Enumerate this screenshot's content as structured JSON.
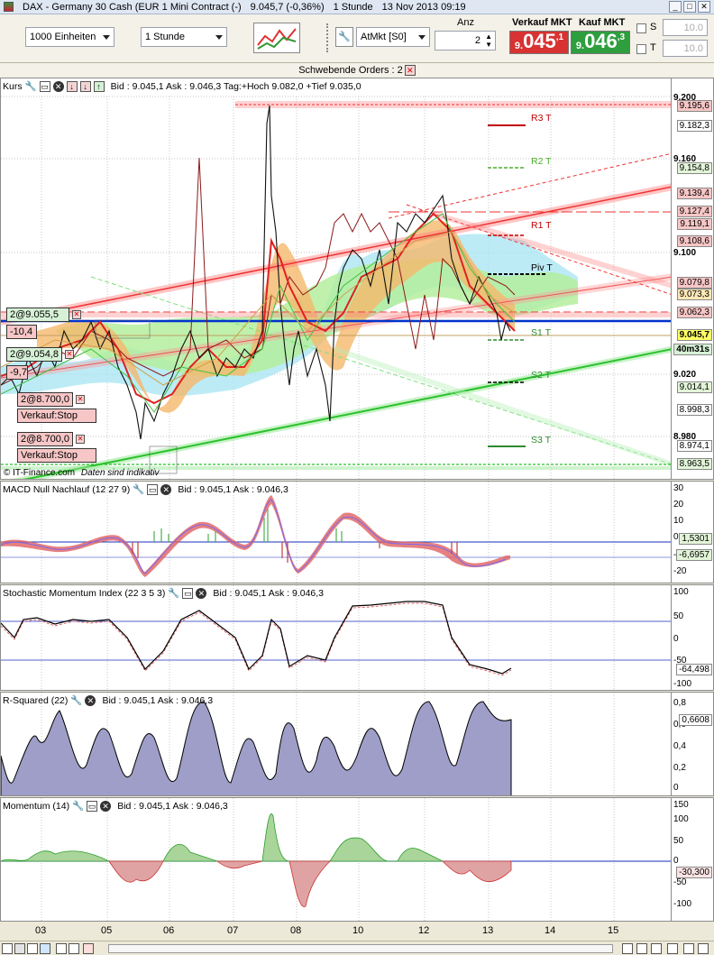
{
  "window": {
    "title": "DAX - Germany 30 Cash (EUR 1 Mini Contract (-)",
    "last": "9.045,7 (-0,36%)",
    "interval": "1 Stunde",
    "datetime": "13 Nov 2013 09:19",
    "controls": [
      "_",
      "□",
      "✕"
    ]
  },
  "toolbar": {
    "units": "1000 Einheiten",
    "timeframe": "1 Stunde",
    "order_type": "AtMkt [S0]",
    "qty_label": "Anz",
    "qty": "2",
    "sell_label": "Verkauf MKT",
    "sell_small": "9.",
    "sell_big": "045",
    "sell_sup": ",1",
    "buy_label": "Kauf MKT",
    "buy_small": "9.",
    "buy_big": "046",
    "buy_sup": ",3",
    "s_label": "S",
    "t_label": "T",
    "s_value": "10.0",
    "t_value": "10.0",
    "sell_color": "#d83232",
    "buy_color": "#2e9e3e"
  },
  "pending": {
    "label": "Schwebende Orders : 2"
  },
  "main": {
    "title": "Kurs",
    "info": "Bid : 9.045,1 Ask : 9.046,3 Tag:+Hoch 9.082,0 +Tief 9.035,0",
    "footer_left": "© IT-Finance.com",
    "footer_right": "Daten sind indikativ",
    "ticks": [
      "9.200",
      "9.160",
      "9.100",
      "9.020",
      "8.980"
    ],
    "price_labels": [
      {
        "v": "9.195,6",
        "c": "#f7c6c6"
      },
      {
        "v": "9.182,3",
        "c": "#fff"
      },
      {
        "v": "9.154,8",
        "c": "#e3f5d9"
      },
      {
        "v": "9.139,4",
        "c": "#f7c6c6"
      },
      {
        "v": "9.127,4",
        "c": "#f7c6c6"
      },
      {
        "v": "9.119,1",
        "c": "#f7c6c6"
      },
      {
        "v": "9.108,6",
        "c": "#f7c6c6"
      },
      {
        "v": "9.079,8",
        "c": "#f7c6c6"
      },
      {
        "v": "9.073,3",
        "c": "#fde8b7"
      },
      {
        "v": "9.062,3",
        "c": "#f7c6c6"
      },
      {
        "v": "9.045,7",
        "c": "#ffff66"
      },
      {
        "v": "40m31s",
        "c": "#d7f1d7"
      },
      {
        "v": "9.014,1",
        "c": "#e3f5d9"
      },
      {
        "v": "8.998,3",
        "c": "#fff"
      },
      {
        "v": "8.974,1",
        "c": "#fff"
      },
      {
        "v": "8.963,5",
        "c": "#e3f5d9"
      }
    ],
    "pivots": [
      {
        "l": "R3 T",
        "c": "#c00000"
      },
      {
        "l": "R2 T",
        "c": "#4caf2a"
      },
      {
        "l": "R1 T",
        "c": "#c00000"
      },
      {
        "l": "Piv T",
        "c": "#000"
      },
      {
        "l": "S1 T",
        "c": "#2e8b2e"
      },
      {
        "l": "S2 T",
        "c": "#2e8b2e"
      },
      {
        "l": "S3 T",
        "c": "#2e8b2e"
      }
    ],
    "orders": [
      {
        "t": "2@9.055,5",
        "c": "#d7f1d7"
      },
      {
        "t": "-10,4",
        "c": "#f7c6c6"
      },
      {
        "t": "2@9.054,8",
        "c": "#d7f1d7"
      },
      {
        "t": "-9,7",
        "c": "#f7c6c6"
      },
      {
        "t": "2@8.700,0",
        "c": "#f7c6c6"
      },
      {
        "t": "Verkauf:Stop",
        "c": "#f7c6c6"
      },
      {
        "t": "2@8.700,0",
        "c": "#f7c6c6"
      },
      {
        "t": "Verkauf:Stop",
        "c": "#f7c6c6"
      }
    ]
  },
  "macd": {
    "title": "MACD Null Nachlauf (12 27 9)",
    "info": "Bid : 9.045,1 Ask : 9.046,3",
    "ticks": [
      "30",
      "20",
      "10",
      "0",
      "-10",
      "-20"
    ],
    "v1": "1,5301",
    "v2": "-6,6957"
  },
  "stoch": {
    "title": "Stochastic Momentum Index (22 3 5 3)",
    "info": "Bid : 9.045,1 Ask : 9.046,3",
    "ticks": [
      "100",
      "50",
      "0",
      "-50",
      "-100"
    ],
    "v1": "-64,498"
  },
  "rsq": {
    "title": "R-Squared (22)",
    "info": "Bid : 9.045,1 Ask : 9.046,3",
    "ticks": [
      "0,8",
      "0,6",
      "0,4",
      "0,2",
      "0"
    ],
    "v1": "0,6608"
  },
  "momentum": {
    "title": "Momentum (14)",
    "info": "Bid : 9.045,1 Ask : 9.046,3",
    "ticks": [
      "150",
      "100",
      "50",
      "0",
      "-50",
      "-100"
    ],
    "v1": "-30,300"
  },
  "xaxis": [
    "03",
    "05",
    "06",
    "07",
    "08",
    "10",
    "12",
    "13",
    "14",
    "15"
  ]
}
